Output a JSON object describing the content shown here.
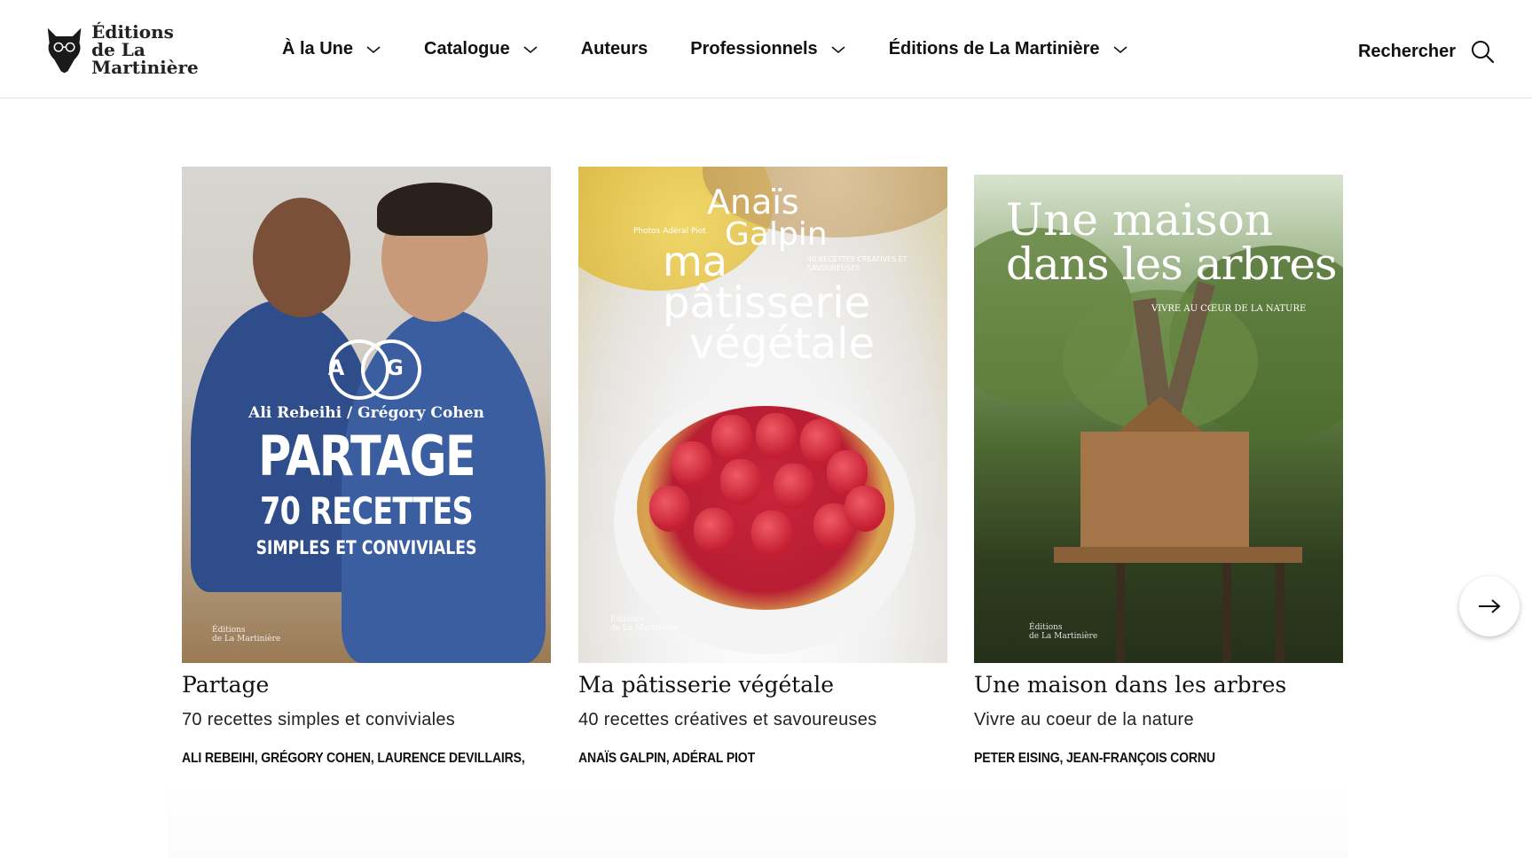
{
  "header": {
    "logo_line1": "Éditions",
    "logo_line2": "de La Martinière",
    "nav": [
      {
        "label": "À la Une",
        "has_dropdown": true,
        "icon": "chevron-down-icon"
      },
      {
        "label": "Catalogue",
        "has_dropdown": true,
        "icon": "chevron-down-icon"
      },
      {
        "label": "Auteurs",
        "has_dropdown": false
      },
      {
        "label": "Professionnels",
        "has_dropdown": true,
        "icon": "chevron-down-icon"
      },
      {
        "label": "Éditions de La Martinière",
        "has_dropdown": true,
        "icon": "chevron-down-icon"
      }
    ],
    "search_label": "Rechercher",
    "search_icon": "search-icon"
  },
  "books": [
    {
      "title": "Partage",
      "subtitle": "70 recettes simples et conviviales",
      "authors": "Ali Rebeihi, Grégory Cohen, Laurence Devillairs, Guillaume Czerw",
      "cover": {
        "monogram_left": "A",
        "monogram_right": "G",
        "authors_line": "Ali Rebeihi / Grégory Cohen",
        "title_big": "PARTAGE",
        "line2": "70 RECETTES",
        "line3": "SIMPLES ET CONVIVIALES",
        "imprint1": "Éditions",
        "imprint2": "de La Martinière"
      }
    },
    {
      "title": "Ma pâtisserie végétale",
      "subtitle": "40 recettes créatives et savoureuses",
      "authors": "Anaïs Galpin, Adéral Piot",
      "cover": {
        "author1": "Anaïs",
        "author2": "Galpin",
        "photo_credit": "Photos Adéral Piot",
        "tagline": "40 RECETTES CRÉATIVES ET SAVOUREUSES",
        "title1": "ma",
        "title2": "pâtisserie",
        "title3": "végétale",
        "imprint1": "Éditions",
        "imprint2": "de La Martinière"
      }
    },
    {
      "title": "Une maison dans les arbres",
      "subtitle": "Vivre au coeur de la nature",
      "authors": "Peter Eising, Jean-François Cornu",
      "cover": {
        "title1": "Une maison",
        "title2": "dans les arbres",
        "tagline": "VIVRE AU CŒUR DE LA NATURE",
        "imprint1": "Éditions",
        "imprint2": "de La Martinière"
      }
    }
  ],
  "carousel": {
    "next_icon": "arrow-right-icon"
  }
}
